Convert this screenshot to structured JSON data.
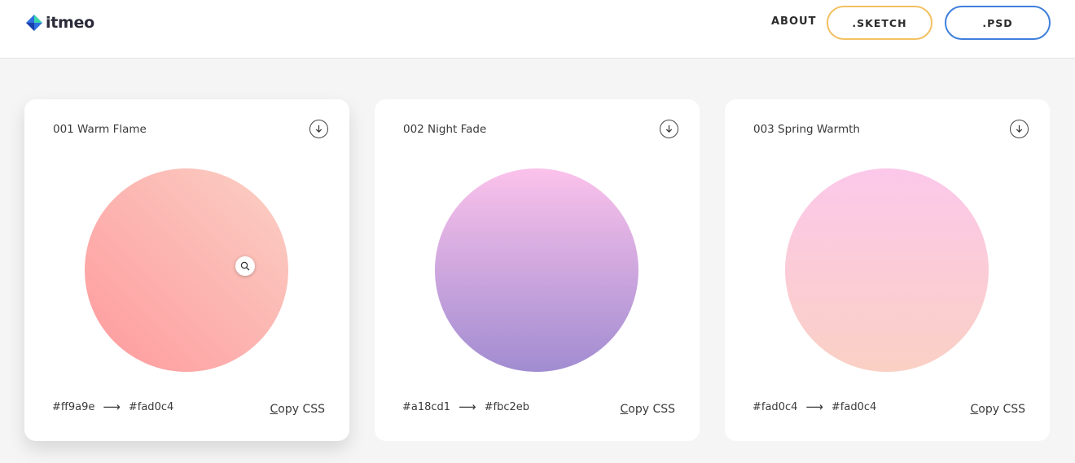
{
  "header": {
    "logo_text": "itmeo",
    "nav": {
      "about": "ABOUT",
      "sketch": ".SKETCH",
      "psd": ".PSD"
    },
    "colors": {
      "sketch_border": "#f2c163",
      "psd_border": "#3f7fdc"
    }
  },
  "cards": [
    {
      "title": "001 Warm Flame",
      "from": "#ff9a9e",
      "to": "#fad0c4",
      "arrow": "⟶",
      "copy_first": "C",
      "copy_rest": "opy CSS",
      "icons": [
        "download-icon",
        "zoom-icon"
      ]
    },
    {
      "title": "002 Night Fade",
      "from": "#a18cd1",
      "to": "#fbc2eb",
      "arrow": "⟶",
      "copy_first": "C",
      "copy_rest": "opy CSS",
      "icons": [
        "download-icon"
      ]
    },
    {
      "title": "003 Spring Warmth",
      "from": "#fad0c4",
      "to": "#fad0c4",
      "arrow": "⟶",
      "copy_first": "C",
      "copy_rest": "opy CSS",
      "icons": [
        "download-icon"
      ]
    }
  ]
}
